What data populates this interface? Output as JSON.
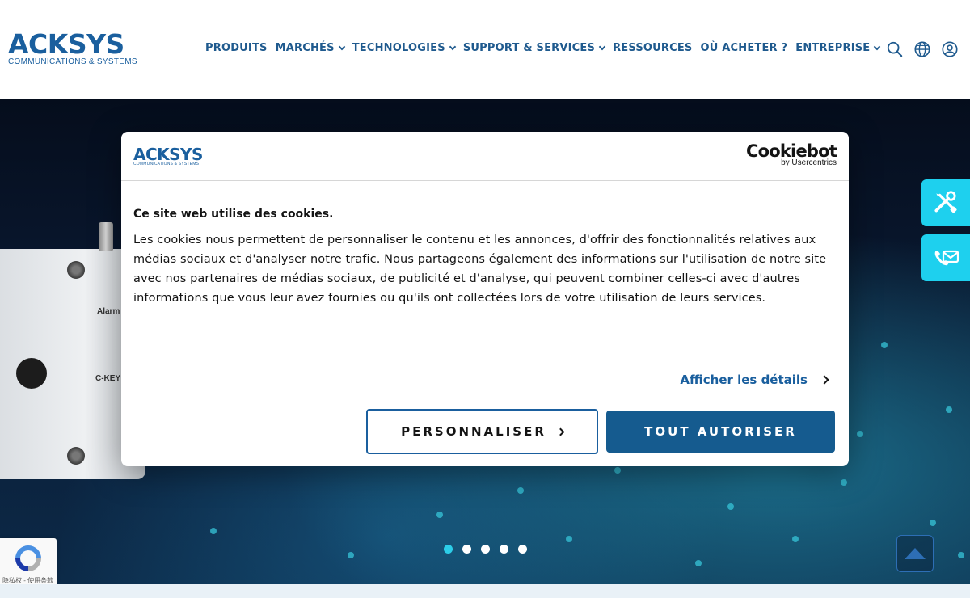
{
  "header": {
    "logo_main": "ACKSYS",
    "logo_sub": "COMMUNICATIONS & SYSTEMS",
    "nav": [
      {
        "label": "PRODUITS",
        "dropdown": false
      },
      {
        "label": "MARCHÉS",
        "dropdown": true
      },
      {
        "label": "TECHNOLOGIES",
        "dropdown": true
      },
      {
        "label": "SUPPORT & SERVICES",
        "dropdown": true
      },
      {
        "label": "RESSOURCES",
        "dropdown": false
      },
      {
        "label": "OÙ ACHETER ?",
        "dropdown": false
      },
      {
        "label": "ENTREPRISE",
        "dropdown": true
      }
    ],
    "icons": [
      "search-icon",
      "globe-icon",
      "user-icon"
    ]
  },
  "hero": {
    "device_labels": {
      "alarm": "Alarm",
      "ckey": "C-KEY"
    },
    "carousel": {
      "count": 5,
      "active_index": 0
    }
  },
  "cookie_dialog": {
    "logo_main": "ACKSYS",
    "logo_sub": "COMMUNICATIONS & SYSTEMS",
    "provider": "Cookiebot",
    "provider_sub": "by Usercentrics",
    "title": "Ce site web utilise des cookies.",
    "body": "Les cookies nous permettent de personnaliser le contenu et les annonces, d'offrir des fonctionnalités relatives aux médias sociaux et d'analyser notre trafic. Nous partageons également des informations sur l'utilisation de notre site avec nos partenaires de médias sociaux, de publicité et d'analyse, qui peuvent combiner celles-ci avec d'autres informations que vous leur avez fournies ou qu'ils ont collectées lors de votre utilisation de leurs services.",
    "details_link": "Afficher les détails",
    "customize_button": "PERSONNALISER",
    "accept_all_button": "TOUT AUTORISER"
  },
  "recaptcha": {
    "text": "隐私权 - 使用条款"
  },
  "colors": {
    "brand": "#1a5f9e",
    "accent_cyan": "#1ed0ee",
    "button_primary": "#155b8f"
  }
}
